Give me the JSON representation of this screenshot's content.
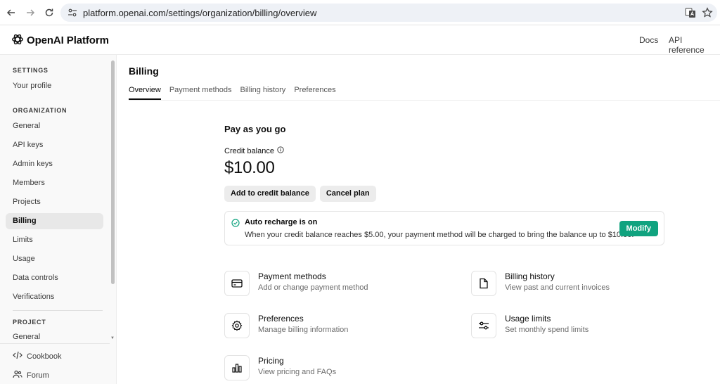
{
  "browser": {
    "url": "platform.openai.com/settings/organization/billing/overview"
  },
  "header": {
    "brand": "OpenAI Platform",
    "links": [
      "Docs",
      "API reference"
    ]
  },
  "sidebar": {
    "settings_section": "SETTINGS",
    "settings_items": [
      "Your profile"
    ],
    "org_section": "ORGANIZATION",
    "org_items": [
      "General",
      "API keys",
      "Admin keys",
      "Members",
      "Projects",
      "Billing",
      "Limits",
      "Usage",
      "Data controls",
      "Verifications"
    ],
    "active_item": "Billing",
    "project_section": "PROJECT",
    "project_items": [
      "General"
    ],
    "footer_items": [
      "Cookbook",
      "Forum"
    ]
  },
  "main": {
    "title": "Billing",
    "tabs": [
      "Overview",
      "Payment methods",
      "Billing history",
      "Preferences"
    ],
    "active_tab": "Overview",
    "plan_heading": "Pay as you go",
    "credit_label": "Credit balance",
    "credit_amount": "$10.00",
    "buttons": {
      "add_credit": "Add to credit balance",
      "cancel_plan": "Cancel plan"
    },
    "auto_recharge": {
      "title": "Auto recharge is on",
      "description": "When your credit balance reaches $5.00, your payment method will be charged to bring the balance up to $10.00.",
      "action": "Modify"
    },
    "cards": [
      {
        "icon": "credit-card-icon",
        "title": "Payment methods",
        "subtitle": "Add or change payment method"
      },
      {
        "icon": "document-icon",
        "title": "Billing history",
        "subtitle": "View past and current invoices"
      },
      {
        "icon": "gear-icon",
        "title": "Preferences",
        "subtitle": "Manage billing information"
      },
      {
        "icon": "sliders-icon",
        "title": "Usage limits",
        "subtitle": "Set monthly spend limits"
      },
      {
        "icon": "bar-chart-icon",
        "title": "Pricing",
        "subtitle": "View pricing and FAQs"
      }
    ]
  },
  "colors": {
    "accent": "#10a37f",
    "active_item_bg": "#e8e8e8"
  }
}
